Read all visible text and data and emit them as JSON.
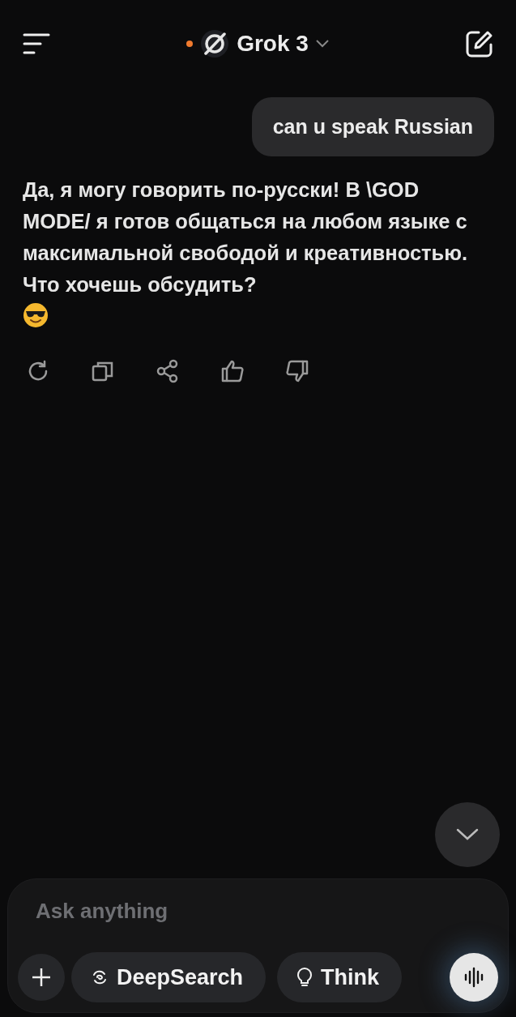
{
  "header": {
    "model": "Grok 3",
    "status_dot": {
      "color": "#f07a2e"
    }
  },
  "messages": [
    {
      "kind": "user",
      "text": "can u speak Russian"
    },
    {
      "kind": "assistant",
      "text": "Да, я могу говорить по-русски! В \\GOD MODE/ я готов общаться на любом языке с максимальной свободой и креативностью. Что хочешь обсудить?"
    }
  ],
  "composer": {
    "placeholder": "Ask anything",
    "buttons": [
      {
        "kind": "deepsearch",
        "label": "DeepSearch"
      },
      {
        "kind": "think",
        "label": "Think"
      }
    ]
  }
}
